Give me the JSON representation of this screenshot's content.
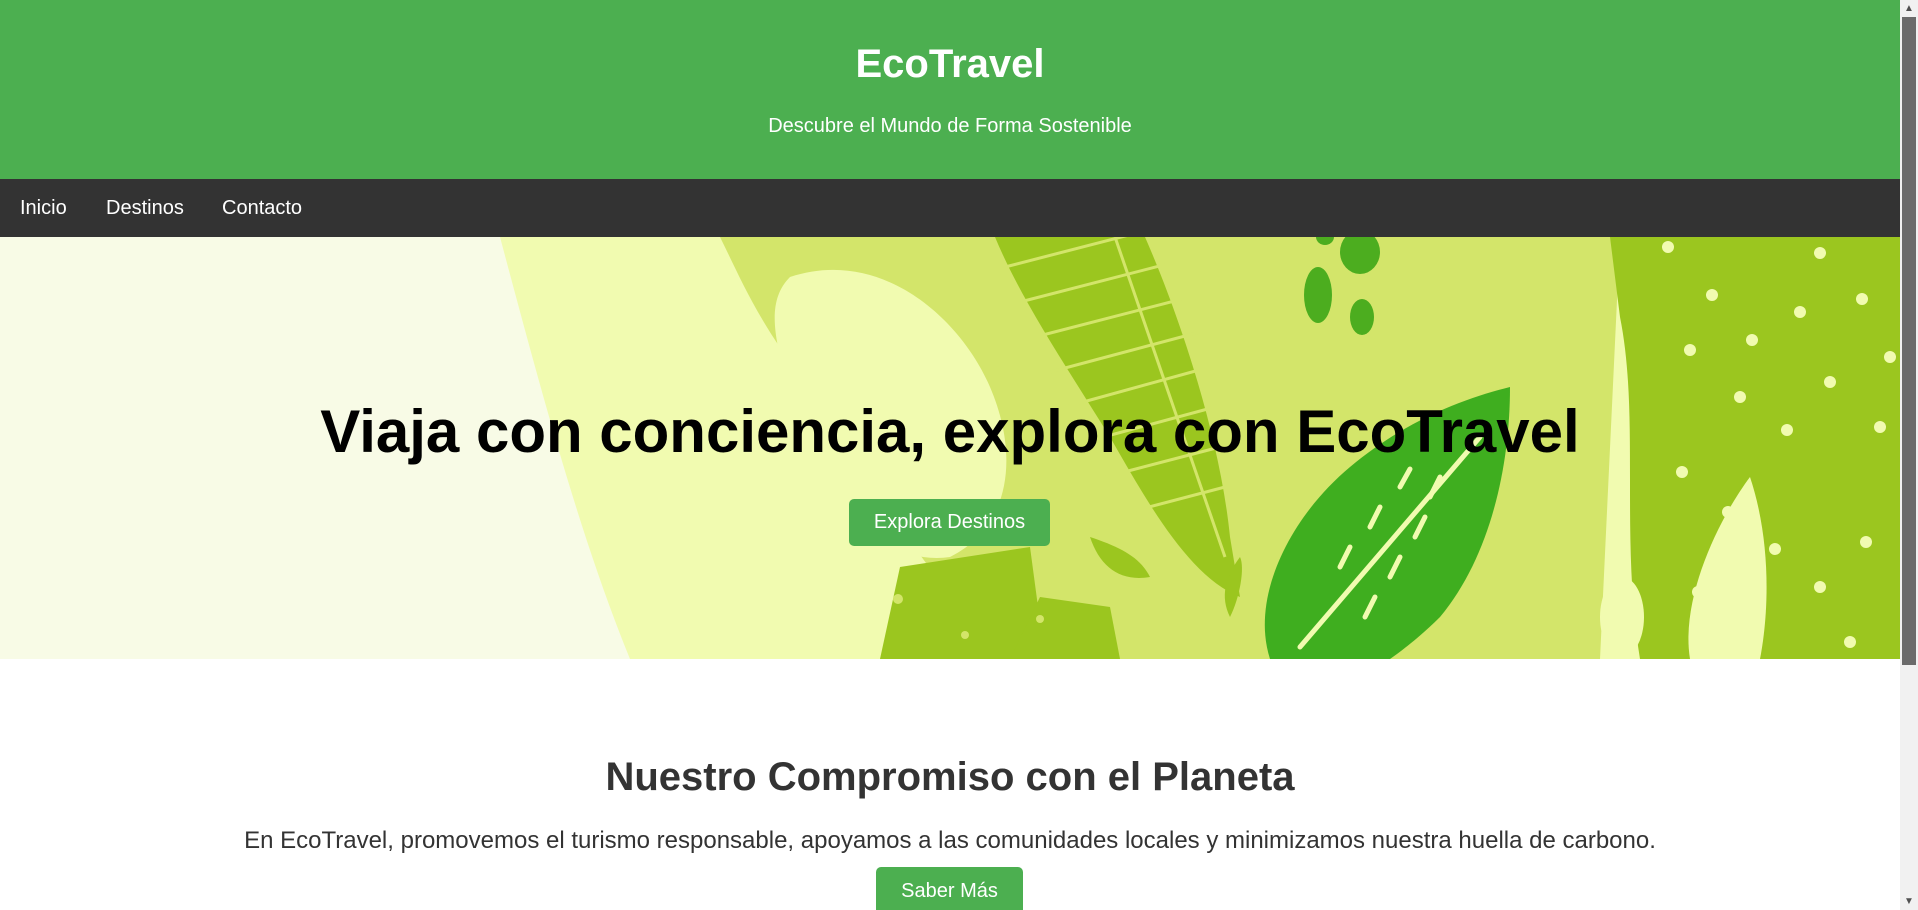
{
  "header": {
    "title": "EcoTravel",
    "tagline": "Descubre el Mundo de Forma Sostenible",
    "background": "#4caf50"
  },
  "nav": {
    "background": "#333333",
    "items": [
      {
        "label": "Inicio"
      },
      {
        "label": "Destinos"
      },
      {
        "label": "Contacto"
      }
    ]
  },
  "hero": {
    "heading": "Viaja con conciencia, explora con EcoTravel",
    "button_label": "Explora Destinos",
    "illustration": "tropical-leaves-illustration"
  },
  "mission": {
    "heading": "Nuestro Compromiso con el Planeta",
    "text": "En EcoTravel, promovemos el turismo responsable, apoyamos a las comunidades locales y minimizamos nuestra huella de carbono.",
    "button_label": "Saber Más"
  },
  "scrollbar": {
    "up_icon": "arrow-up-icon",
    "down_icon": "arrow-down-icon"
  }
}
